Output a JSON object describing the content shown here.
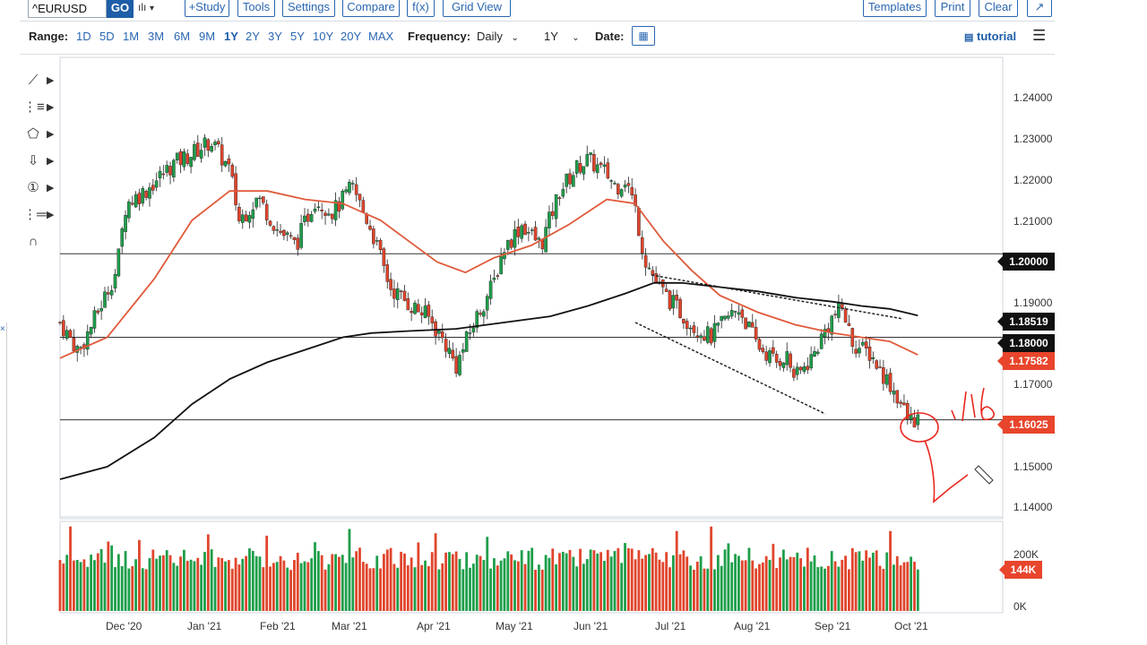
{
  "toolbar": {
    "symbol": "^EURUSD",
    "go_label": "GO",
    "study_label": "+Study",
    "tools_label": "Tools",
    "settings_label": "Settings",
    "compare_label": "Compare",
    "fx_label": "f(x)",
    "gridview_label": "Grid View",
    "templates_label": "Templates",
    "print_label": "Print",
    "clear_label": "Clear"
  },
  "rangebar": {
    "range_label": "Range:",
    "ranges": [
      "1D",
      "5D",
      "1M",
      "3M",
      "6M",
      "9M",
      "1Y",
      "2Y",
      "3Y",
      "5Y",
      "10Y",
      "20Y",
      "MAX"
    ],
    "active_range": "1Y",
    "frequency_label": "Frequency:",
    "frequency_value": "Daily",
    "period_value": "1Y",
    "date_label": "Date:",
    "tutorial_label": "tutorial"
  },
  "chart_data": {
    "type": "candlestick",
    "ylim": [
      1.137,
      1.247
    ],
    "yticks": [
      "1.24000",
      "1.23000",
      "1.22000",
      "1.21000",
      "1.19000",
      "1.17000",
      "1.15000",
      "1.14000"
    ],
    "xticks": [
      "Dec '20",
      "Jan '21",
      "Feb '21",
      "Mar '21",
      "Apr '21",
      "May '21",
      "Jun '21",
      "Jul '21",
      "Aug '21",
      "Sep '21",
      "Oct '21"
    ],
    "price_labels": [
      {
        "value": "1.20000",
        "color": "#111111"
      },
      {
        "value": "1.18519",
        "color": "#111111"
      },
      {
        "value": "1.18000",
        "color": "#111111"
      },
      {
        "value": "1.17582",
        "color": "#e8452c"
      },
      {
        "value": "1.16025",
        "color": "#e8452c"
      }
    ],
    "horizontal_lines": [
      1.2,
      1.18,
      1.16025
    ],
    "close_path": [
      [
        0,
        1.1835
      ],
      [
        0.02,
        1.1765
      ],
      [
        0.04,
        1.186
      ],
      [
        0.06,
        1.196
      ],
      [
        0.07,
        1.212
      ],
      [
        0.09,
        1.215
      ],
      [
        0.12,
        1.2215
      ],
      [
        0.14,
        1.224
      ],
      [
        0.16,
        1.227
      ],
      [
        0.18,
        1.22
      ],
      [
        0.19,
        1.208
      ],
      [
        0.21,
        1.2135
      ],
      [
        0.23,
        1.206
      ],
      [
        0.25,
        1.202
      ],
      [
        0.27,
        1.213
      ],
      [
        0.29,
        1.21
      ],
      [
        0.31,
        1.216
      ],
      [
        0.33,
        1.206
      ],
      [
        0.35,
        1.192
      ],
      [
        0.37,
        1.188
      ],
      [
        0.39,
        1.185
      ],
      [
        0.41,
        1.178
      ],
      [
        0.42,
        1.173
      ],
      [
        0.44,
        1.184
      ],
      [
        0.46,
        1.193
      ],
      [
        0.47,
        1.201
      ],
      [
        0.49,
        1.207
      ],
      [
        0.51,
        1.202
      ],
      [
        0.53,
        1.215
      ],
      [
        0.55,
        1.221
      ],
      [
        0.56,
        1.2225
      ],
      [
        0.58,
        1.219
      ],
      [
        0.59,
        1.216
      ],
      [
        0.6,
        1.218
      ],
      [
        0.61,
        1.211
      ],
      [
        0.62,
        1.199
      ],
      [
        0.635,
        1.192
      ],
      [
        0.65,
        1.188
      ],
      [
        0.67,
        1.183
      ],
      [
        0.69,
        1.18
      ],
      [
        0.71,
        1.185
      ],
      [
        0.72,
        1.187
      ],
      [
        0.74,
        1.178
      ],
      [
        0.76,
        1.174
      ],
      [
        0.77,
        1.176
      ],
      [
        0.78,
        1.17
      ],
      [
        0.8,
        1.176
      ],
      [
        0.81,
        1.181
      ],
      [
        0.82,
        1.185
      ],
      [
        0.83,
        1.187
      ],
      [
        0.84,
        1.179
      ],
      [
        0.85,
        1.177
      ],
      [
        0.86,
        1.176
      ],
      [
        0.87,
        1.172
      ],
      [
        0.88,
        1.169
      ],
      [
        0.89,
        1.165
      ],
      [
        0.9,
        1.16
      ],
      [
        0.91,
        1.1605
      ]
    ],
    "ma50_path": [
      [
        0,
        1.175
      ],
      [
        0.05,
        1.18
      ],
      [
        0.1,
        1.194
      ],
      [
        0.14,
        1.208
      ],
      [
        0.18,
        1.215
      ],
      [
        0.22,
        1.215
      ],
      [
        0.26,
        1.213
      ],
      [
        0.3,
        1.212
      ],
      [
        0.34,
        1.208
      ],
      [
        0.37,
        1.203
      ],
      [
        0.4,
        1.198
      ],
      [
        0.43,
        1.1955
      ],
      [
        0.46,
        1.199
      ],
      [
        0.5,
        1.202
      ],
      [
        0.54,
        1.207
      ],
      [
        0.58,
        1.213
      ],
      [
        0.61,
        1.212
      ],
      [
        0.64,
        1.203
      ],
      [
        0.67,
        1.196
      ],
      [
        0.7,
        1.19
      ],
      [
        0.74,
        1.186
      ],
      [
        0.78,
        1.183
      ],
      [
        0.82,
        1.181
      ],
      [
        0.85,
        1.18
      ],
      [
        0.88,
        1.179
      ],
      [
        0.91,
        1.1758
      ]
    ],
    "ma200_path": [
      [
        0,
        1.146
      ],
      [
        0.05,
        1.149
      ],
      [
        0.1,
        1.156
      ],
      [
        0.14,
        1.164
      ],
      [
        0.18,
        1.17
      ],
      [
        0.22,
        1.174
      ],
      [
        0.26,
        1.177
      ],
      [
        0.3,
        1.18
      ],
      [
        0.33,
        1.181
      ],
      [
        0.37,
        1.1815
      ],
      [
        0.42,
        1.182
      ],
      [
        0.47,
        1.1835
      ],
      [
        0.52,
        1.185
      ],
      [
        0.56,
        1.1875
      ],
      [
        0.6,
        1.1905
      ],
      [
        0.63,
        1.193
      ],
      [
        0.66,
        1.193
      ],
      [
        0.7,
        1.192
      ],
      [
        0.74,
        1.191
      ],
      [
        0.78,
        1.1895
      ],
      [
        0.82,
        1.1885
      ],
      [
        0.85,
        1.1875
      ],
      [
        0.88,
        1.1868
      ],
      [
        0.91,
        1.1852
      ]
    ],
    "volume_axis": [
      "200K",
      "0K"
    ],
    "volume_last": "144K",
    "volume_ylim": [
      0,
      240
    ]
  }
}
